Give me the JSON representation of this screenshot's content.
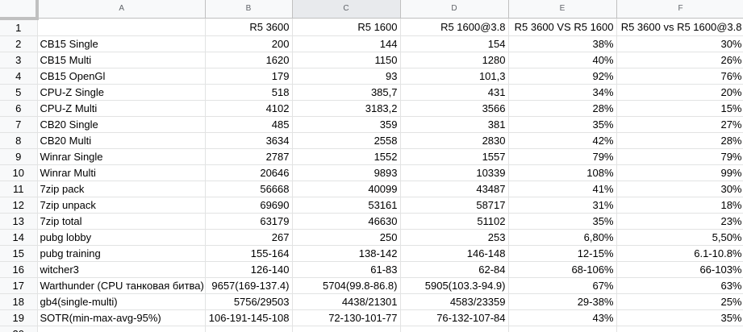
{
  "columns": [
    "A",
    "B",
    "C",
    "D",
    "E",
    "F"
  ],
  "rows": [
    {
      "num": "1",
      "cells": [
        "",
        "R5 3600",
        "R5 1600",
        "R5 1600@3.8",
        "R5 3600 VS R5 1600",
        "R5 3600 vs R5 1600@3.8"
      ]
    },
    {
      "num": "2",
      "cells": [
        "CB15 Single",
        "200",
        "144",
        "154",
        "38%",
        "30%"
      ]
    },
    {
      "num": "3",
      "cells": [
        "CB15 Multi",
        "1620",
        "1150",
        "1280",
        "40%",
        "26%"
      ]
    },
    {
      "num": "4",
      "cells": [
        "CB15 OpenGl",
        "179",
        "93",
        "101,3",
        "92%",
        "76%"
      ]
    },
    {
      "num": "5",
      "cells": [
        "CPU-Z Single",
        "518",
        "385,7",
        "431",
        "34%",
        "20%"
      ]
    },
    {
      "num": "6",
      "cells": [
        "CPU-Z Multi",
        "4102",
        "3183,2",
        "3566",
        "28%",
        "15%"
      ]
    },
    {
      "num": "7",
      "cells": [
        "CB20 Single",
        "485",
        "359",
        "381",
        "35%",
        "27%"
      ]
    },
    {
      "num": "8",
      "cells": [
        "CB20 Multi",
        "3634",
        "2558",
        "2830",
        "42%",
        "28%"
      ]
    },
    {
      "num": "9",
      "cells": [
        "Winrar Single",
        "2787",
        "1552",
        "1557",
        "79%",
        "79%"
      ]
    },
    {
      "num": "10",
      "cells": [
        "Winrar Multi",
        "20646",
        "9893",
        "10339",
        "108%",
        "99%"
      ]
    },
    {
      "num": "11",
      "cells": [
        "7zip pack",
        "56668",
        "40099",
        "43487",
        "41%",
        "30%"
      ]
    },
    {
      "num": "12",
      "cells": [
        "7zip unpack",
        "69690",
        "53161",
        "58717",
        "31%",
        "18%"
      ]
    },
    {
      "num": "13",
      "cells": [
        "7zip total",
        "63179",
        "46630",
        "51102",
        "35%",
        "23%"
      ]
    },
    {
      "num": "14",
      "cells": [
        "pubg lobby",
        "267",
        "250",
        "253",
        "6,80%",
        "5,50%"
      ]
    },
    {
      "num": "15",
      "cells": [
        "pubg training",
        "155-164",
        "138-142",
        "146-148",
        "12-15%",
        "6.1-10.8%"
      ]
    },
    {
      "num": "16",
      "cells": [
        "witcher3",
        "126-140",
        "61-83",
        "62-84",
        "68-106%",
        "66-103%"
      ]
    },
    {
      "num": "17",
      "cells": [
        "Warthunder (CPU танковая битва)",
        "9657(169-137.4)",
        "5704(99.8-86.8)",
        "5905(103.3-94.9)",
        "67%",
        "63%"
      ]
    },
    {
      "num": "18",
      "cells": [
        "gb4(single-multi)",
        "5756/29503",
        "4438/21301",
        "4583/23359",
        "29-38%",
        "25%"
      ]
    },
    {
      "num": "19",
      "cells": [
        "SOTR(min-max-avg-95%)",
        "106-191-145-108",
        "72-130-101-77",
        "76-132-107-84",
        "43%",
        "35%"
      ]
    },
    {
      "num": "20",
      "cells": [
        "",
        "",
        "",
        "",
        "",
        ""
      ]
    }
  ]
}
